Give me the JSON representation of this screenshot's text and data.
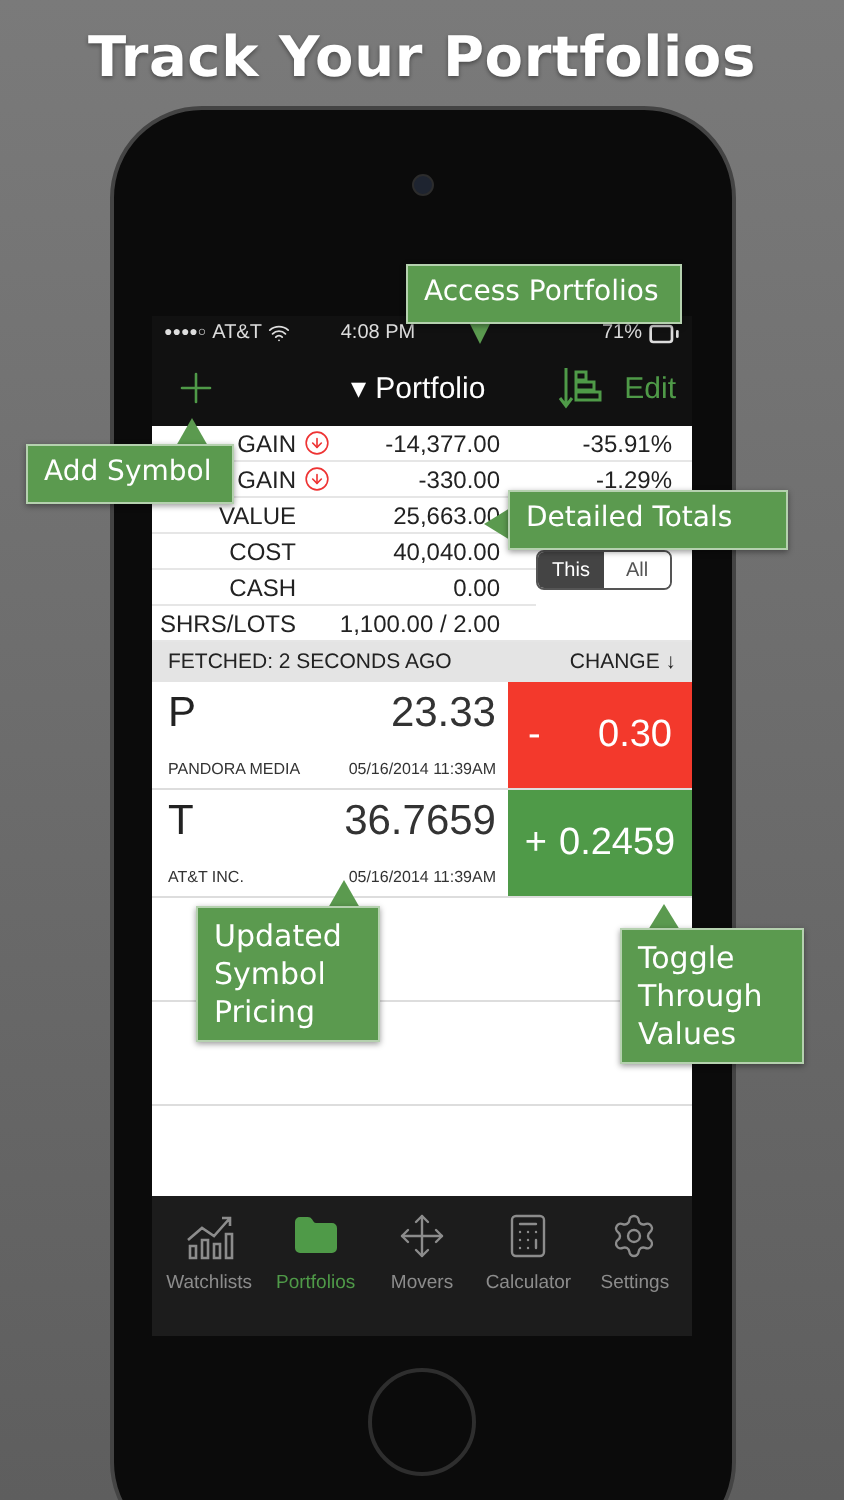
{
  "headline": "Track Your Portfolios",
  "status_bar": {
    "signal": "●●●●○",
    "carrier": "AT&T",
    "time": "4:08 PM",
    "battery": "71%"
  },
  "nav_bar": {
    "caret": "▾",
    "title": "Portfolio",
    "edit": "Edit"
  },
  "totals": [
    {
      "label": "GAIN",
      "down": true,
      "value": "-14,377.00",
      "percent": "-35.91%"
    },
    {
      "label": "GAIN",
      "down": true,
      "value": "-330.00",
      "percent": "-1.29%"
    },
    {
      "label": "VALUE",
      "down": false,
      "value": "25,663.00"
    },
    {
      "label": "COST",
      "down": false,
      "value": "40,040.00"
    },
    {
      "label": "CASH",
      "down": false,
      "value": "0.00"
    },
    {
      "label": "SHRS/LOTS",
      "down": false,
      "value": "1,100.00 / 2.00"
    }
  ],
  "segments": [
    {
      "label": "This",
      "selected": true
    },
    {
      "label": "All",
      "selected": false
    }
  ],
  "list_header": {
    "fetched": "FETCHED: 2 SECONDS AGO",
    "sort": "CHANGE ↓"
  },
  "quotes": [
    {
      "symbol": "P",
      "price": "23.33",
      "name": "PANDORA MEDIA",
      "time": "05/16/2014 11:39AM",
      "up": false,
      "sign": "-",
      "amount": "0.30"
    },
    {
      "symbol": "T",
      "price": "36.7659",
      "name": "AT&T INC.",
      "time": "05/16/2014 11:39AM",
      "up": true,
      "sign": "+",
      "amount": "0.2459"
    }
  ],
  "tab_bar": [
    {
      "kind": "watchlists",
      "label": "Watchlists",
      "selected": false
    },
    {
      "kind": "portfolios",
      "label": "Portfolios",
      "selected": true
    },
    {
      "kind": "movers",
      "label": "Movers",
      "selected": false
    },
    {
      "kind": "calculator",
      "label": "Calculator",
      "selected": false
    },
    {
      "kind": "settings",
      "label": "Settings",
      "selected": false
    }
  ],
  "callouts": [
    {
      "kind": "access",
      "text": "Access Portfolios"
    },
    {
      "kind": "add",
      "text": "Add Symbol"
    },
    {
      "kind": "totals",
      "text": "Detailed Totals"
    },
    {
      "kind": "pricing",
      "text": "Updated Symbol Pricing"
    },
    {
      "kind": "toggle",
      "text": "Toggle Through Values"
    }
  ]
}
